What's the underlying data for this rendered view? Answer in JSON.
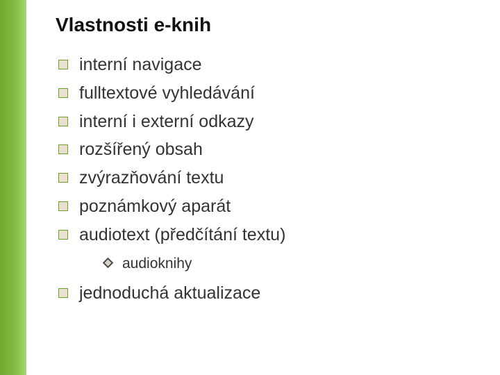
{
  "title": "Vlastnosti e-knih",
  "items": [
    {
      "text": "interní navigace"
    },
    {
      "text": "fulltextové vyhledávání"
    },
    {
      "text": "interní i externí odkazy"
    },
    {
      "text": "rozšířený obsah"
    },
    {
      "text": "zvýrazňování textu"
    },
    {
      "text": "poznámkový aparát"
    },
    {
      "text": "audiotext (předčítání textu)",
      "sub": [
        {
          "text": "audioknihy"
        }
      ]
    },
    {
      "text": "jednoduchá aktualizace"
    }
  ]
}
